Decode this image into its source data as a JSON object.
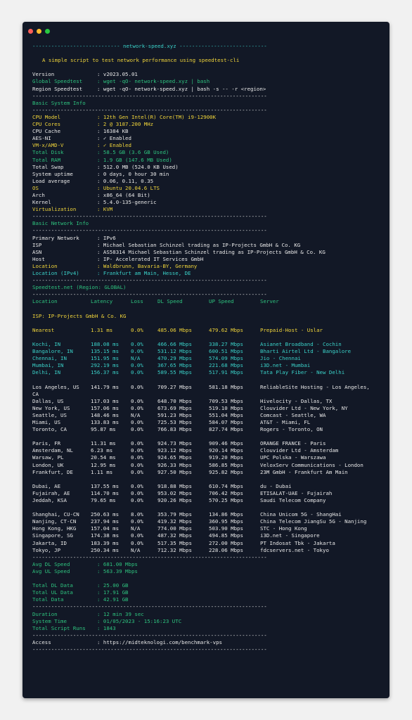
{
  "window": {
    "dots": [
      "#ff5f57",
      "#febc2e",
      "#28c840"
    ]
  },
  "header": {
    "rule": "---------------------------- network-speed.xyz ----------------------------",
    "tagline": "A simple script to test network performance using speedtest-cli"
  },
  "separator": "---------------------------------------------------------------------------",
  "info": [
    {
      "k": "Version",
      "v": ": v2023.05.01",
      "cls": "w"
    },
    {
      "k": "Global Speedtest",
      "v": ": wget -qO- network-speed.xyz | bash",
      "cls": "g"
    },
    {
      "k": "Region Speedtest",
      "v": ": wget -qO- network-speed.xyz | bash -s -- -r <region>",
      "cls": "w"
    }
  ],
  "system": {
    "title": "Basic System Info",
    "rows": [
      {
        "k": "CPU Model",
        "v": ": 12th Gen Intel(R) Core(TM) i9-12900K",
        "cls": "y"
      },
      {
        "k": "CPU Cores",
        "v": ": 2 @ 3187.200 MHz",
        "cls": "y"
      },
      {
        "k": "CPU Cache",
        "v": ": 16384 KB",
        "cls": "w"
      },
      {
        "k": "AES-NI",
        "v": ": ✓ Enabled",
        "cls": "w"
      },
      {
        "k": "VM-x/AMD-V",
        "v": ": ✓ Enabled",
        "cls": "y"
      },
      {
        "k": "Total Disk",
        "v": ": 58.5 GB (3.6 GB Used)",
        "cls": "g"
      },
      {
        "k": "Total RAM",
        "v": ": 1.9 GB (147.6 MB Used)",
        "cls": "g"
      },
      {
        "k": "Total Swap",
        "v": ": 512.0 MB (524.0 KB Used)",
        "cls": "w"
      },
      {
        "k": "System uptime",
        "v": ": 0 days, 0 hour 30 min",
        "cls": "w"
      },
      {
        "k": "Load average",
        "v": ": 0.06, 0.11, 0.35",
        "cls": "w"
      },
      {
        "k": "OS",
        "v": ": Ubuntu 20.04.6 LTS",
        "cls": "y"
      },
      {
        "k": "Arch",
        "v": ": x86_64 (64 Bit)",
        "cls": "w"
      },
      {
        "k": "Kernel",
        "v": ": 5.4.0-135-generic",
        "cls": "w"
      },
      {
        "k": "Virtualization",
        "v": ": KVM",
        "cls": "y"
      }
    ]
  },
  "network": {
    "title": "Basic Network Info",
    "rows": [
      {
        "k": "Primary Network",
        "v": ": IPv6",
        "cls": "w"
      },
      {
        "k": "ISP",
        "v": ": Michael Sebastian Schinzel trading as IP-Projects GmbH & Co. KG",
        "cls": "w"
      },
      {
        "k": "ASN",
        "v": ": AS58314 Michael Sebastian Schinzel trading as IP-Projects GmbH & Co. KG",
        "cls": "w"
      },
      {
        "k": "Host",
        "v": ": IP- Accelerated IT Services GmbH",
        "cls": "w"
      },
      {
        "k": "Location",
        "v": ": Waldbrunn, Bavaria-BY, Germany",
        "cls": "y"
      },
      {
        "k": "Location (IPv4)",
        "v": ": Frankfurt am Main, Hesse, DE",
        "cls": "c"
      }
    ]
  },
  "speedtest": {
    "title": "Speedtest.net (Region: GLOBAL)",
    "columns": [
      "Location",
      "Latency",
      "Loss",
      "DL Speed",
      "UP Speed",
      "Server"
    ],
    "isp": "ISP: IP-Projects GmbH & Co. KG",
    "groups": [
      {
        "cls": "y",
        "rows": [
          [
            "Nearest",
            "1.31 ms",
            "0.0%",
            "485.06 Mbps",
            "479.62 Mbps",
            "Prepaid-Host - Uslar"
          ]
        ]
      },
      {
        "cls": "c",
        "rows": [
          [
            "Kochi, IN",
            "188.08 ms",
            "0.0%",
            "466.66 Mbps",
            "338.27 Mbps",
            "Asianet Broadband - Cochin"
          ],
          [
            "Bangalore, IN",
            "135.15 ms",
            "0.0%",
            "531.12 Mbps",
            "600.51 Mbps",
            "Bharti Airtel Ltd - Bangalore"
          ],
          [
            "Chennai, IN",
            "151.95 ms",
            "N/A",
            "470.29 Mbps",
            "574.09 Mbps",
            "Jio - Chennai"
          ],
          [
            "Mumbai, IN",
            "292.19 ms",
            "0.0%",
            "367.65 Mbps",
            "221.68 Mbps",
            "i3D.net - Mumbai"
          ],
          [
            "Delhi, IN",
            "156.37 ms",
            "0.0%",
            "589.55 Mbps",
            "517.91 Mbps",
            "Tata Play Fiber - New Delhi"
          ]
        ]
      },
      {
        "cls": "w",
        "rows": [
          [
            "Los Angeles, US",
            "141.79 ms",
            "0.0%",
            "709.27 Mbps",
            "581.18 Mbps",
            "ReliableSite Hosting - Los Angeles,"
          ],
          [
            "CA",
            "",
            "",
            "",
            "",
            ""
          ],
          [
            "Dallas, US",
            "117.03 ms",
            "0.0%",
            "648.70 Mbps",
            "709.53 Mbps",
            "Hivelocity - Dallas, TX"
          ],
          [
            "New York, US",
            "157.06 ms",
            "0.0%",
            "673.69 Mbps",
            "519.10 Mbps",
            "Clouvider Ltd - New York, NY"
          ],
          [
            "Seattle, US",
            "148.46 ms",
            "N/A",
            "591.23 Mbps",
            "551.04 Mbps",
            "Comcast - Seattle, WA"
          ],
          [
            "Miami, US",
            "133.83 ms",
            "0.0%",
            "725.53 Mbps",
            "584.07 Mbps",
            "AT&T - Miami, FL"
          ],
          [
            "Toronto, CA",
            "95.87 ms",
            "0.0%",
            "766.83 Mbps",
            "827.74 Mbps",
            "Rogers - Toronto, ON"
          ]
        ]
      },
      {
        "cls": "w",
        "rows": [
          [
            "Paris, FR",
            "11.31 ms",
            "0.0%",
            "924.73 Mbps",
            "909.46 Mbps",
            "ORANGE FRANCE - Paris"
          ],
          [
            "Amsterdam, NL",
            "6.23 ms",
            "0.0%",
            "923.12 Mbps",
            "920.14 Mbps",
            "Clouvider Ltd - Amsterdam"
          ],
          [
            "Warsaw, PL",
            "20.54 ms",
            "0.0%",
            "924.65 Mbps",
            "919.20 Mbps",
            "UPC Polska - Warszawa"
          ],
          [
            "London, UK",
            "12.95 ms",
            "0.0%",
            "926.33 Mbps",
            "586.85 Mbps",
            "VeloxServ Communications - London"
          ],
          [
            "Frankfurt, DE",
            "1.11 ms",
            "0.0%",
            "927.50 Mbps",
            "925.82 Mbps",
            "23M GmbH - Frankfurt Am Main"
          ]
        ]
      },
      {
        "cls": "w",
        "rows": [
          [
            "Dubai, AE",
            "137.55 ms",
            "0.0%",
            "918.88 Mbps",
            "610.74 Mbps",
            "du - Dubai"
          ],
          [
            "Fujairah, AE",
            "114.70 ms",
            "0.0%",
            "953.02 Mbps",
            "706.42 Mbps",
            "ETISALAT-UAE - Fujairah"
          ],
          [
            "Jeddah, KSA",
            "79.65 ms",
            "0.0%",
            "920.26 Mbps",
            "570.25 Mbps",
            "Saudi Telecom Company"
          ]
        ]
      },
      {
        "cls": "w",
        "rows": [
          [
            "Shanghai, CU-CN",
            "250.63 ms",
            "8.0%",
            "353.79 Mbps",
            "134.86 Mbps",
            "China Unicom 5G - ShangHai"
          ],
          [
            "Nanjing, CT-CN",
            "237.94 ms",
            "0.0%",
            "419.32 Mbps",
            "360.95 Mbps",
            "China Telecom JiangSu 5G - Nanjing"
          ],
          [
            "Hong Kong, HKG",
            "157.04 ms",
            "N/A",
            "774.00 Mbps",
            "503.90 Mbps",
            "STC - Hong Kong"
          ],
          [
            "Singapore, SG",
            "174.38 ms",
            "0.0%",
            "487.32 Mbps",
            "494.85 Mbps",
            "i3D.net - Singapore"
          ],
          [
            "Jakarta, ID",
            "183.39 ms",
            "0.0%",
            "517.35 Mbps",
            "272.00 Mbps",
            "PT Indosat Tbk - Jakarta"
          ],
          [
            "Tokyo, JP",
            "250.34 ms",
            "N/A",
            "712.32 Mbps",
            "228.06 Mbps",
            "fdcservers.net - Tokyo"
          ]
        ]
      }
    ]
  },
  "averages": [
    {
      "k": "Avg DL Speed",
      "v": ": 681.00 Mbps"
    },
    {
      "k": "Avg UL Speed",
      "v": ": 563.39 Mbps"
    }
  ],
  "totals": [
    {
      "k": "Total DL Data",
      "v": ": 25.00 GB"
    },
    {
      "k": "Total UL Data",
      "v": ": 17.91 GB"
    },
    {
      "k": "Total Data",
      "v": ": 42.91 GB"
    }
  ],
  "run": [
    {
      "k": "Duration",
      "v": ": 12 min 39 sec"
    },
    {
      "k": "System Time",
      "v": ": 01/05/2023 - 15:16:23 UTC"
    },
    {
      "k": "Total Script Runs",
      "v": ": 1843"
    }
  ],
  "access": {
    "k": "Access",
    "v": ": https://midteknologi.com/benchmark-vps"
  }
}
